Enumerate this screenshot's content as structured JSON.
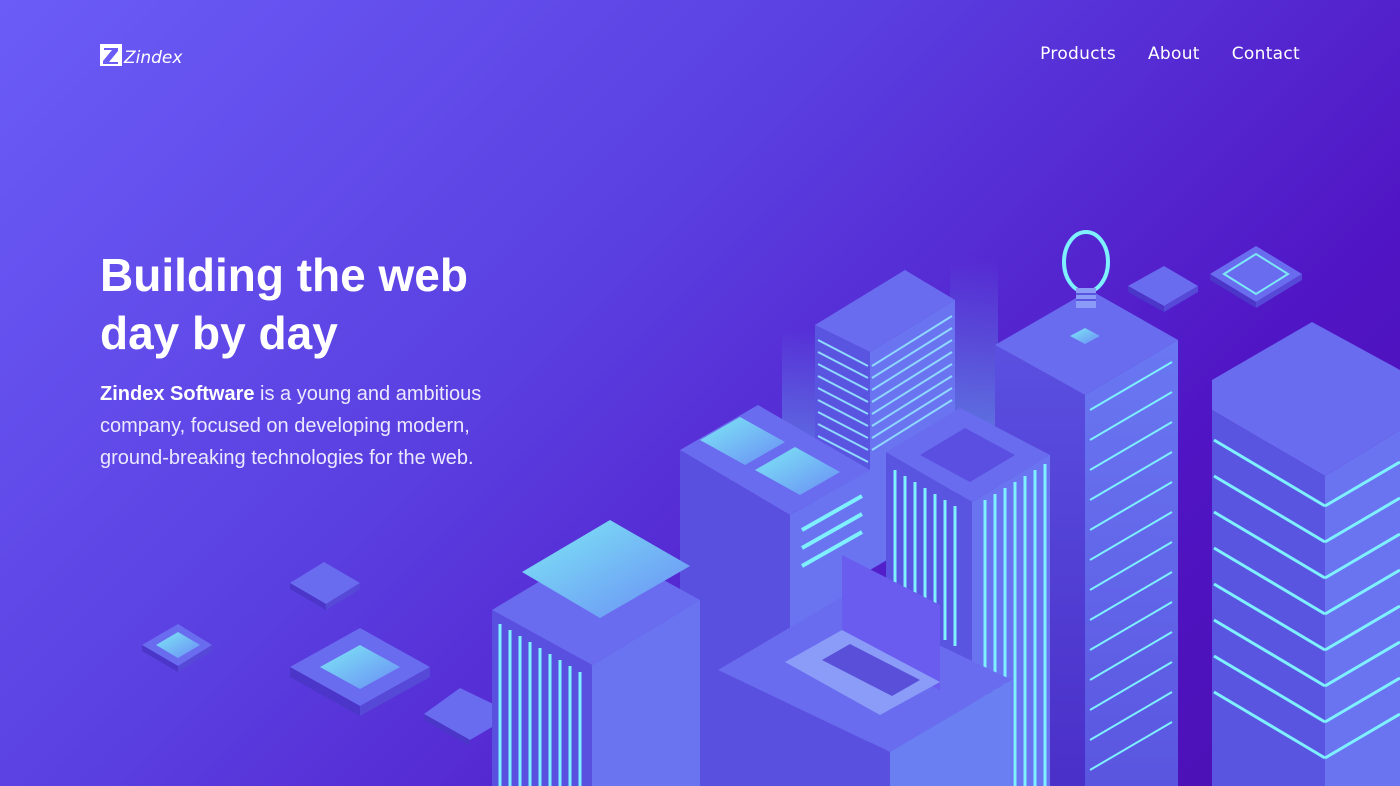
{
  "brand": {
    "logo_text": "Zindex"
  },
  "nav": {
    "items": [
      "Products",
      "About",
      "Contact"
    ]
  },
  "hero": {
    "title_line1": "Building the web",
    "title_line2": "day by day",
    "company_name": "Zindex Software",
    "description": " is a young and ambitious company, focused on developing modern, ground-breaking technologies for the web."
  },
  "colors": {
    "bg_start": "#6b5cf7",
    "bg_end": "#4a10b0",
    "accent_cyan": "#5ef0f0",
    "building_face": "#6a6cf0"
  },
  "icons": [
    "lightbulb-icon",
    "laptop-icon"
  ]
}
